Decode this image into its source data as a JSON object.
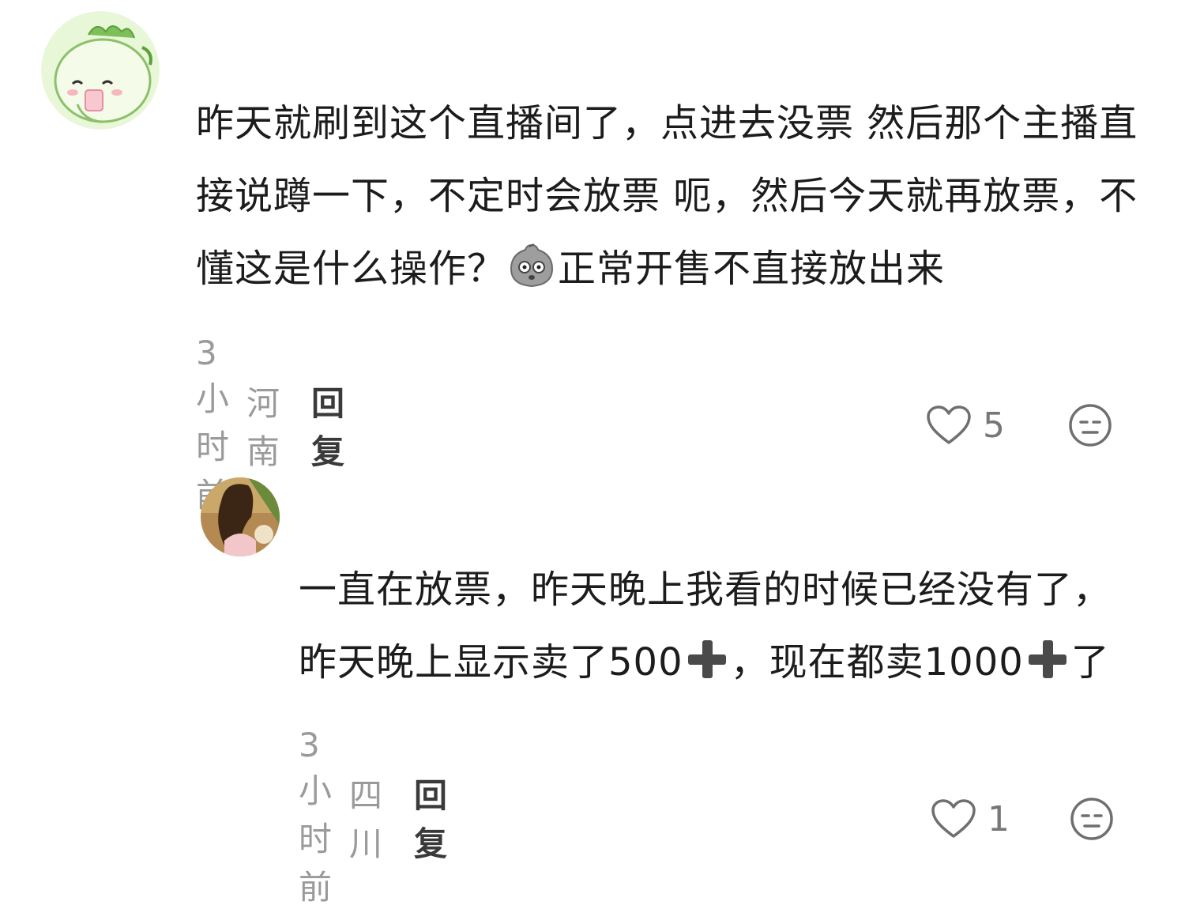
{
  "comments": [
    {
      "text_before_emoji": "昨天就刷到这个直播间了，点进去没票 然后那个主播直接说蹲一下，不定时会放票 呃，然后今天就再放票，不懂这是什么操作？",
      "text_after_emoji": "正常开售不直接放出来",
      "time": "3小时前",
      "location": "河南",
      "reply_label": "回复",
      "likes": "5",
      "emoji_icon": "stunned-face-emoji",
      "avatar_icon": "dinosaur-avatar"
    },
    {
      "text_part1": "一直在放票，昨天晚上我看的时候已经没有了，昨天晚上显示卖了500",
      "text_part2": "，现在都卖1000",
      "text_part3": "了",
      "time": "3小时前",
      "location": "四川",
      "reply_label": "回复",
      "likes": "1",
      "plus_icon": "heavy-plus-emoji",
      "avatar_icon": "girl-photo-avatar"
    }
  ],
  "colors": {
    "meta_gray": "#9a9a9a",
    "text": "#1c1c1c",
    "reply": "#3a3a3a"
  }
}
